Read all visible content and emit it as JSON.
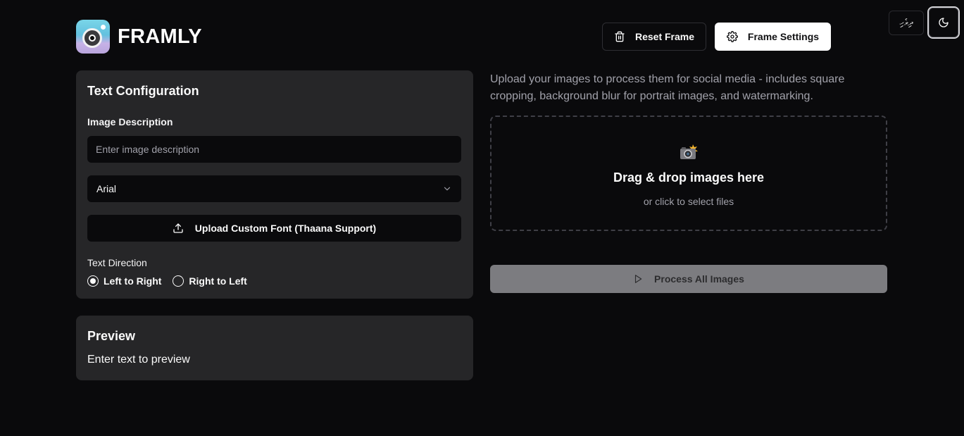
{
  "header": {
    "brand": "FRAMLY",
    "reset_label": "Reset Frame",
    "settings_label": "Frame Settings",
    "language_label": "ދިވެހި"
  },
  "config": {
    "title": "Text Configuration",
    "description_label": "Image Description",
    "description_placeholder": "Enter image description",
    "description_value": "",
    "font_selected": "Arial",
    "upload_font_label": "Upload Custom Font (Thaana Support)",
    "direction_label": "Text Direction",
    "direction_options": [
      "Left to Right",
      "Right to Left"
    ],
    "direction_selected": "Left to Right"
  },
  "preview": {
    "title": "Preview",
    "text": "Enter text to preview"
  },
  "uploader": {
    "intro": "Upload your images to process them for social media - includes square cropping, background blur for portrait images, and watermarking.",
    "icon": "camera-flash-icon",
    "drop_title": "Drag & drop images here",
    "drop_subtitle": "or click to select files",
    "process_label": "Process All Images"
  },
  "icons": {
    "reset": "trash-icon",
    "settings": "gear-icon",
    "theme": "moon-icon",
    "select": "chevron-down-icon",
    "upload": "upload-icon",
    "process": "play-icon"
  },
  "colors": {
    "background": "#0a0a0c",
    "card": "#262628",
    "primary_button": "#ffffff",
    "disabled_button": "#7c7c80"
  }
}
